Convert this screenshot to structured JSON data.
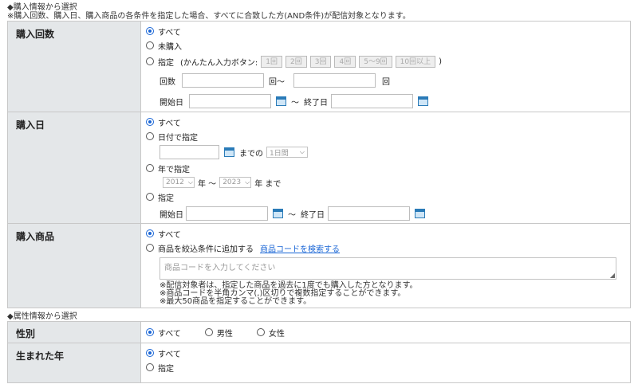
{
  "purchase_section": {
    "title": "◆購入情報から選択",
    "note": "※購入回数、購入日、購入商品の各条件を指定した場合、すべてに合致した方(AND条件)が配信対象となります。"
  },
  "purchase_count": {
    "label": "購入回数",
    "opt_all": "すべて",
    "opt_none": "未購入",
    "opt_specify": "指定",
    "quick_open": "(かんたん入力ボタン:",
    "quick_close": ")",
    "quick_buttons": [
      "1回",
      "2回",
      "3回",
      "4回",
      "5〜9回",
      "10回以上"
    ],
    "count_label": "回数",
    "count_unit_from": "回〜",
    "count_unit_to": "回",
    "start_label": "開始日",
    "tilde": "〜",
    "end_label": "終了日"
  },
  "purchase_date": {
    "label": "購入日",
    "opt_all": "すべて",
    "opt_date": "日付で指定",
    "until": "までの",
    "period_value": "1日間",
    "opt_year": "年で指定",
    "year_from": "2012",
    "year_mid": "年 〜",
    "year_to": "2023",
    "year_end": "年 まで",
    "opt_specify": "指定",
    "start_label": "開始日",
    "tilde": "〜",
    "end_label": "終了日"
  },
  "purchase_product": {
    "label": "購入商品",
    "opt_all": "すべて",
    "opt_add": "商品を絞込条件に追加する",
    "search_link": "商品コードを検索する",
    "code_placeholder": "商品コードを入力してください",
    "note1": "※配信対象者は、指定した商品を過去に1度でも購入した方となります。",
    "note2": "※商品コードを半角カンマ(,)区切りで複数指定することができます。",
    "note3": "※最大50商品を指定することができます。"
  },
  "attr_section": {
    "title": "◆属性情報から選択"
  },
  "gender": {
    "label": "性別",
    "opt_all": "すべて",
    "opt_male": "男性",
    "opt_female": "女性"
  },
  "birth_year": {
    "label": "生まれた年",
    "opt_all": "すべて",
    "opt_specify": "指定"
  },
  "colors": {
    "accent": "#1a66d6",
    "label_bg": "#e4e7e9",
    "border": "#c8c8c8",
    "calendar": "#2a7bb8"
  }
}
